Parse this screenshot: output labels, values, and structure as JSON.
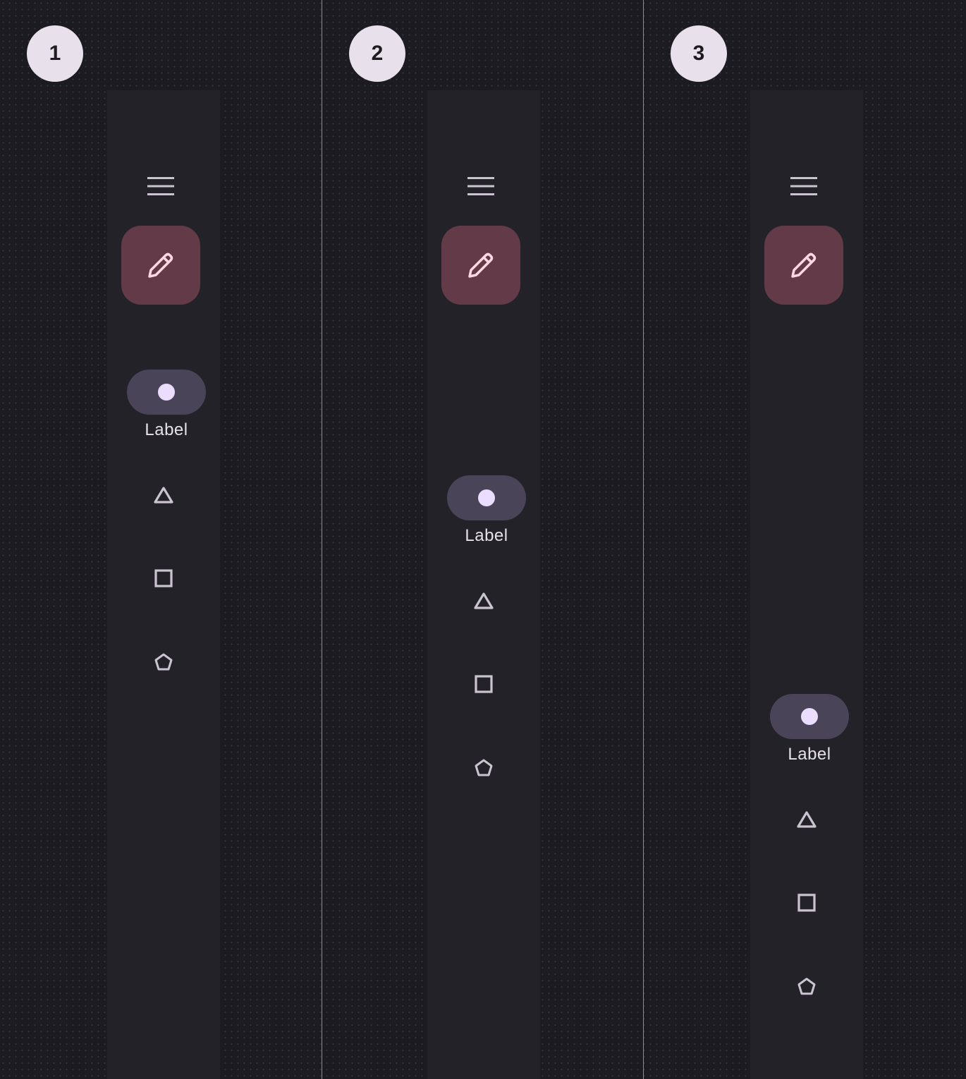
{
  "panels": [
    {
      "badge": "1",
      "active_label": "Label"
    },
    {
      "badge": "2",
      "active_label": "Label"
    },
    {
      "badge": "3",
      "active_label": "Label"
    }
  ],
  "icons": {
    "menu": "menu-icon",
    "fab": "pencil-icon",
    "active": "circle-icon",
    "items": [
      "triangle-icon",
      "square-icon",
      "pentagon-icon"
    ]
  },
  "colors": {
    "background": "#1c1b21",
    "rail": "#232229",
    "fab": "#633b48",
    "fab_icon": "#ffd8e4",
    "indicator": "#4a4458",
    "indicator_dot": "#eaddff",
    "icon": "#cac4d0",
    "badge": "#e8e1ec"
  }
}
